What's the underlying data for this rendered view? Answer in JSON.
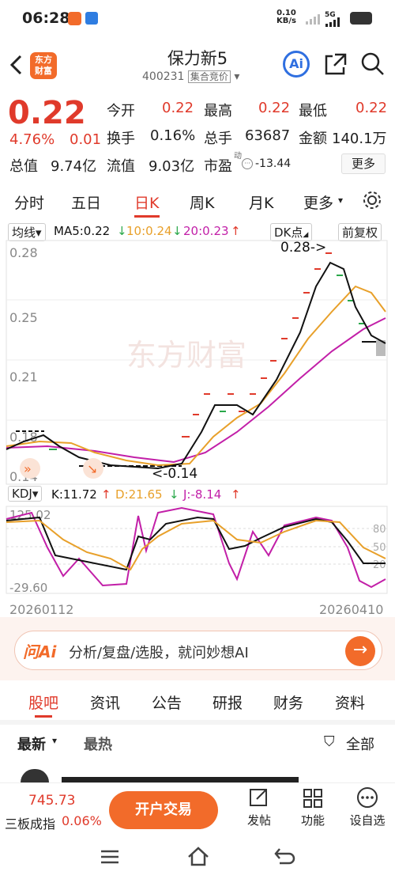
{
  "status": {
    "time": "06:28",
    "net_speed_value": "0.10",
    "net_speed_unit": "KB/s",
    "signal": "5G"
  },
  "header": {
    "logo_line1": "东方",
    "logo_line2": "财富",
    "stock_name": "保力新5",
    "stock_code": "400231",
    "auction_tag": "集合竞价",
    "ai_label": "Ai"
  },
  "quote": {
    "price": "0.22",
    "change_pct": "4.76%",
    "change_amt": "0.01",
    "open_label": "今开",
    "open": "0.22",
    "high_label": "最高",
    "high": "0.22",
    "low_label": "最低",
    "low": "0.22",
    "turnover_label": "换手",
    "turnover": "0.16%",
    "volume_label": "总手",
    "volume": "63687",
    "amount_label": "金额",
    "amount": "140.1万",
    "mktcap_label": "总值",
    "mktcap": "9.74亿",
    "float_label": "流值",
    "float": "9.03亿",
    "pe_label": "市盈",
    "pe_sup": "动",
    "pe": "-13.44",
    "more_label": "更多"
  },
  "tabs": [
    "分时",
    "五日",
    "日K",
    "周K",
    "月K",
    "更多"
  ],
  "active_tab": "日K",
  "chart": {
    "ma_selector": "均线",
    "ma5": "MA5:0.22",
    "ma10": "10:0.24",
    "ma20": "20:0.23",
    "dk_label": "DK点",
    "adjust_label": "前复权",
    "y_ticks": [
      "0.28",
      "0.25",
      "0.21",
      "0.18",
      "0.14"
    ],
    "max_annotation": "0.28->",
    "min_annotation": "<-0.14",
    "watermark": "东方财富",
    "kdj_label": "KDJ",
    "k_value": "K:11.72",
    "d_value": "D:21.65",
    "j_value": "J:-8.14",
    "kdj_top": "125.02",
    "kdj_bottom": "-29.60",
    "kdj_levels": [
      "80",
      "50",
      "20"
    ],
    "date_start": "20260112",
    "date_end": "20260410",
    "colors": {
      "ma5": "#111111",
      "ma10": "#e8a02a",
      "ma20": "#c21fa8",
      "up": "#e03a2b",
      "down": "#2aa84a"
    }
  },
  "chart_data": {
    "type": "line",
    "x": [
      "20260112",
      "20260410"
    ],
    "ylim": [
      0.14,
      0.28
    ],
    "series": [
      {
        "name": "MA5",
        "values": [
          0.16,
          0.165,
          0.155,
          0.15,
          0.15,
          0.15,
          0.15,
          0.15,
          0.16,
          0.2,
          0.195,
          0.2,
          0.225,
          0.27,
          0.28,
          0.25,
          0.22
        ]
      },
      {
        "name": "MA10",
        "values": [
          0.16,
          0.16,
          0.16,
          0.155,
          0.152,
          0.15,
          0.148,
          0.15,
          0.16,
          0.18,
          0.19,
          0.2,
          0.22,
          0.25,
          0.265,
          0.26,
          0.24
        ]
      },
      {
        "name": "MA20",
        "values": [
          0.16,
          0.158,
          0.157,
          0.156,
          0.154,
          0.152,
          0.15,
          0.15,
          0.152,
          0.16,
          0.17,
          0.18,
          0.2,
          0.21,
          0.225,
          0.23,
          0.235
        ]
      }
    ]
  },
  "ai_bar": {
    "brand": "问Ai",
    "text": "分析/复盘/选股，就问妙想AI"
  },
  "sub_tabs": [
    "股吧",
    "资讯",
    "公告",
    "研报",
    "财务",
    "资料"
  ],
  "active_sub_tab": "股吧",
  "news": {
    "sort_latest": "最新",
    "sort_hot": "最热",
    "filter_label": "全部"
  },
  "bottom": {
    "index_value": "745.73",
    "index_name": "三板成指",
    "index_change": "0.06%",
    "open_account": "开户交易",
    "post": "发帖",
    "functions": "功能",
    "watchlist": "设自选"
  }
}
